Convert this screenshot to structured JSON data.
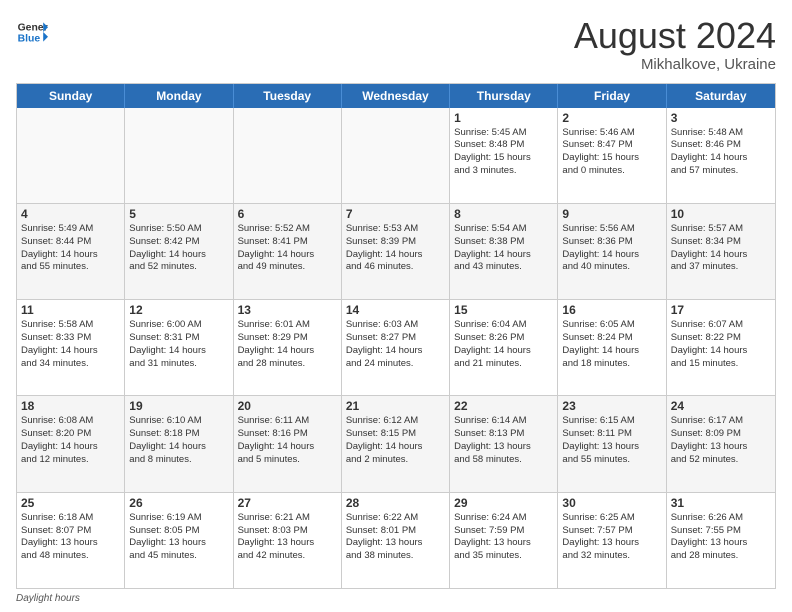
{
  "header": {
    "logo_line1": "General",
    "logo_line2": "Blue",
    "month_year": "August 2024",
    "location": "Mikhalkove, Ukraine"
  },
  "footer": {
    "daylight_hours_label": "Daylight hours"
  },
  "days_of_week": [
    "Sunday",
    "Monday",
    "Tuesday",
    "Wednesday",
    "Thursday",
    "Friday",
    "Saturday"
  ],
  "weeks": [
    [
      {
        "day": "",
        "info": "",
        "empty": true
      },
      {
        "day": "",
        "info": "",
        "empty": true
      },
      {
        "day": "",
        "info": "",
        "empty": true
      },
      {
        "day": "",
        "info": "",
        "empty": true
      },
      {
        "day": "1",
        "info": "Sunrise: 5:45 AM\nSunset: 8:48 PM\nDaylight: 15 hours\nand 3 minutes."
      },
      {
        "day": "2",
        "info": "Sunrise: 5:46 AM\nSunset: 8:47 PM\nDaylight: 15 hours\nand 0 minutes."
      },
      {
        "day": "3",
        "info": "Sunrise: 5:48 AM\nSunset: 8:46 PM\nDaylight: 14 hours\nand 57 minutes."
      }
    ],
    [
      {
        "day": "4",
        "info": "Sunrise: 5:49 AM\nSunset: 8:44 PM\nDaylight: 14 hours\nand 55 minutes."
      },
      {
        "day": "5",
        "info": "Sunrise: 5:50 AM\nSunset: 8:42 PM\nDaylight: 14 hours\nand 52 minutes."
      },
      {
        "day": "6",
        "info": "Sunrise: 5:52 AM\nSunset: 8:41 PM\nDaylight: 14 hours\nand 49 minutes."
      },
      {
        "day": "7",
        "info": "Sunrise: 5:53 AM\nSunset: 8:39 PM\nDaylight: 14 hours\nand 46 minutes."
      },
      {
        "day": "8",
        "info": "Sunrise: 5:54 AM\nSunset: 8:38 PM\nDaylight: 14 hours\nand 43 minutes."
      },
      {
        "day": "9",
        "info": "Sunrise: 5:56 AM\nSunset: 8:36 PM\nDaylight: 14 hours\nand 40 minutes."
      },
      {
        "day": "10",
        "info": "Sunrise: 5:57 AM\nSunset: 8:34 PM\nDaylight: 14 hours\nand 37 minutes."
      }
    ],
    [
      {
        "day": "11",
        "info": "Sunrise: 5:58 AM\nSunset: 8:33 PM\nDaylight: 14 hours\nand 34 minutes."
      },
      {
        "day": "12",
        "info": "Sunrise: 6:00 AM\nSunset: 8:31 PM\nDaylight: 14 hours\nand 31 minutes."
      },
      {
        "day": "13",
        "info": "Sunrise: 6:01 AM\nSunset: 8:29 PM\nDaylight: 14 hours\nand 28 minutes."
      },
      {
        "day": "14",
        "info": "Sunrise: 6:03 AM\nSunset: 8:27 PM\nDaylight: 14 hours\nand 24 minutes."
      },
      {
        "day": "15",
        "info": "Sunrise: 6:04 AM\nSunset: 8:26 PM\nDaylight: 14 hours\nand 21 minutes."
      },
      {
        "day": "16",
        "info": "Sunrise: 6:05 AM\nSunset: 8:24 PM\nDaylight: 14 hours\nand 18 minutes."
      },
      {
        "day": "17",
        "info": "Sunrise: 6:07 AM\nSunset: 8:22 PM\nDaylight: 14 hours\nand 15 minutes."
      }
    ],
    [
      {
        "day": "18",
        "info": "Sunrise: 6:08 AM\nSunset: 8:20 PM\nDaylight: 14 hours\nand 12 minutes."
      },
      {
        "day": "19",
        "info": "Sunrise: 6:10 AM\nSunset: 8:18 PM\nDaylight: 14 hours\nand 8 minutes."
      },
      {
        "day": "20",
        "info": "Sunrise: 6:11 AM\nSunset: 8:16 PM\nDaylight: 14 hours\nand 5 minutes."
      },
      {
        "day": "21",
        "info": "Sunrise: 6:12 AM\nSunset: 8:15 PM\nDaylight: 14 hours\nand 2 minutes."
      },
      {
        "day": "22",
        "info": "Sunrise: 6:14 AM\nSunset: 8:13 PM\nDaylight: 13 hours\nand 58 minutes."
      },
      {
        "day": "23",
        "info": "Sunrise: 6:15 AM\nSunset: 8:11 PM\nDaylight: 13 hours\nand 55 minutes."
      },
      {
        "day": "24",
        "info": "Sunrise: 6:17 AM\nSunset: 8:09 PM\nDaylight: 13 hours\nand 52 minutes."
      }
    ],
    [
      {
        "day": "25",
        "info": "Sunrise: 6:18 AM\nSunset: 8:07 PM\nDaylight: 13 hours\nand 48 minutes."
      },
      {
        "day": "26",
        "info": "Sunrise: 6:19 AM\nSunset: 8:05 PM\nDaylight: 13 hours\nand 45 minutes."
      },
      {
        "day": "27",
        "info": "Sunrise: 6:21 AM\nSunset: 8:03 PM\nDaylight: 13 hours\nand 42 minutes."
      },
      {
        "day": "28",
        "info": "Sunrise: 6:22 AM\nSunset: 8:01 PM\nDaylight: 13 hours\nand 38 minutes."
      },
      {
        "day": "29",
        "info": "Sunrise: 6:24 AM\nSunset: 7:59 PM\nDaylight: 13 hours\nand 35 minutes."
      },
      {
        "day": "30",
        "info": "Sunrise: 6:25 AM\nSunset: 7:57 PM\nDaylight: 13 hours\nand 32 minutes."
      },
      {
        "day": "31",
        "info": "Sunrise: 6:26 AM\nSunset: 7:55 PM\nDaylight: 13 hours\nand 28 minutes."
      }
    ]
  ]
}
